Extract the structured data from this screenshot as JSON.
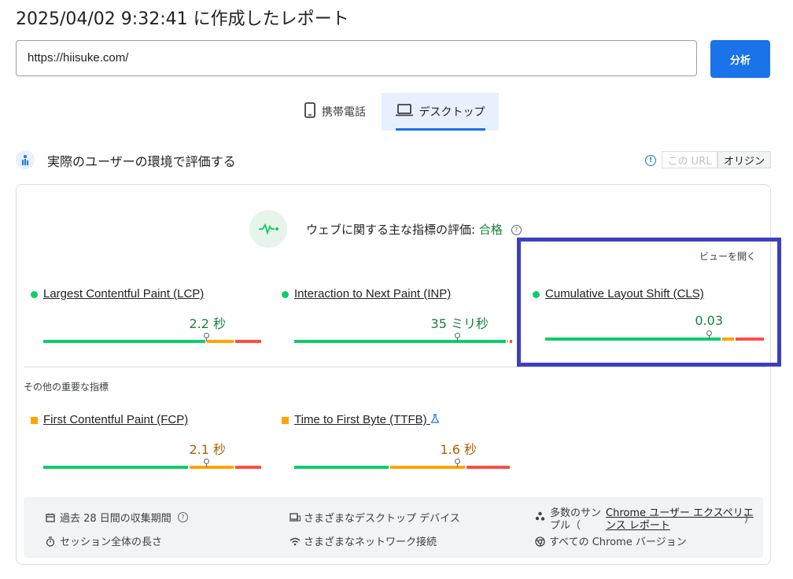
{
  "report": {
    "title": "2025/04/02 9:32:41 に作成したレポート"
  },
  "search": {
    "url": "https://hiisuke.com/",
    "analyze_label": "分析"
  },
  "tabs": [
    {
      "label": "携帯電話",
      "icon": "smartphone-icon",
      "active": false
    },
    {
      "label": "デスクトップ",
      "icon": "laptop-icon",
      "active": true
    }
  ],
  "field": {
    "title": "実際のユーザーの環境で評価する",
    "toggle": {
      "url_label": "この URL",
      "origin_label": "オリジン",
      "selected": "オリジン"
    }
  },
  "cwv": {
    "assessment_label": "ウェブに関する主な指標の評価:",
    "assessment_result": "合格",
    "view_link": "ビューを開く"
  },
  "metrics": [
    {
      "name": "Largest Contentful Paint (LCP)",
      "value": "2.2 秒",
      "status": "good",
      "distribution": {
        "good": 0.75,
        "needs_improvement": 0.13,
        "poor": 0.12
      },
      "p75_fraction": 0.75
    },
    {
      "name": "Interaction to Next Paint (INP)",
      "value": "35 ミリ秒",
      "status": "good",
      "distribution": {
        "good": 0.98,
        "needs_improvement": 0.01,
        "poor": 0.01
      },
      "p75_fraction": 0.75
    },
    {
      "name": "Cumulative Layout Shift (CLS)",
      "value": "0.03",
      "status": "good",
      "distribution": {
        "good": 0.81,
        "needs_improvement": 0.06,
        "poor": 0.13
      },
      "p75_fraction": 0.75
    }
  ],
  "other_metrics": {
    "heading": "その他の重要な指標",
    "items": [
      {
        "name": "First Contentful Paint (FCP)",
        "value": "2.1 秒",
        "status": "needs_improvement",
        "distribution": {
          "good": 0.67,
          "needs_improvement": 0.21,
          "poor": 0.12
        },
        "p75_fraction": 0.75
      },
      {
        "name": "Time to First Byte (TTFB)",
        "value": "1.6 秒",
        "status": "needs_improvement",
        "distribution": {
          "good": 0.44,
          "needs_improvement": 0.35,
          "poor": 0.2
        },
        "p75_fraction": 0.75,
        "experimental": true
      }
    ]
  },
  "footer": {
    "period": "過去 28 日間の収集期間",
    "session": "セッション全体の長さ",
    "devices": "さまざまなデスクトップ デバイス",
    "network": "さまざまなネットワーク接続",
    "samples_prefix": "多数のサン",
    "samples_prefix2": "プル（",
    "samples_link_1": "Chrome ユーザー エクスペリエ",
    "samples_link_2": "ンス レポート",
    "samples_suffix": "）",
    "chrome_versions": "すべての Chrome バージョン"
  },
  "colors": {
    "accent": "#1a73e8",
    "good": "#0cce6b",
    "needs_improvement": "#ffa400",
    "poor": "#ff4e42",
    "highlight": "#3d3fc2"
  }
}
